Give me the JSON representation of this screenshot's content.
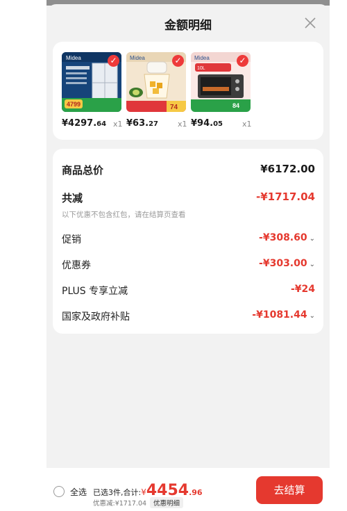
{
  "header": {
    "title": "金额明细",
    "close_icon": "close-icon"
  },
  "products": [
    {
      "name": "Midea refrigerator",
      "price_int": "¥4297.",
      "price_dec": "64",
      "qty": "x1"
    },
    {
      "name": "Midea food chopper",
      "price_int": "¥63.",
      "price_dec": "27",
      "qty": "x1"
    },
    {
      "name": "Midea oven",
      "price_int": "¥94.",
      "price_dec": "05",
      "qty": "x1"
    }
  ],
  "summary": {
    "total_label": "商品总价",
    "total_value": "¥6172.00",
    "reduce_label": "共减",
    "reduce_value": "-¥1717.04",
    "note": "以下优惠不包含红包，请在结算页查看",
    "promo_label": "促销",
    "promo_value": "-¥308.60",
    "coupon_label": "优惠券",
    "coupon_value": "-¥303.00",
    "plus_label": "PLUS 专享立减",
    "plus_value": "-¥24",
    "subsidy_label": "国家及政府补贴",
    "subsidy_value": "-¥1081.44",
    "caret": "⌄"
  },
  "footer": {
    "select_all": "全选",
    "selected_text": "已选3件,合计:",
    "currency": "¥",
    "amount_int": "4454",
    "amount_dec": ".96",
    "discount_text": "优惠减:¥1717.04",
    "detail_btn": "优惠明细",
    "checkout": "去结算"
  },
  "colors": {
    "accent": "#e5392f",
    "background": "#f2f2f2"
  }
}
